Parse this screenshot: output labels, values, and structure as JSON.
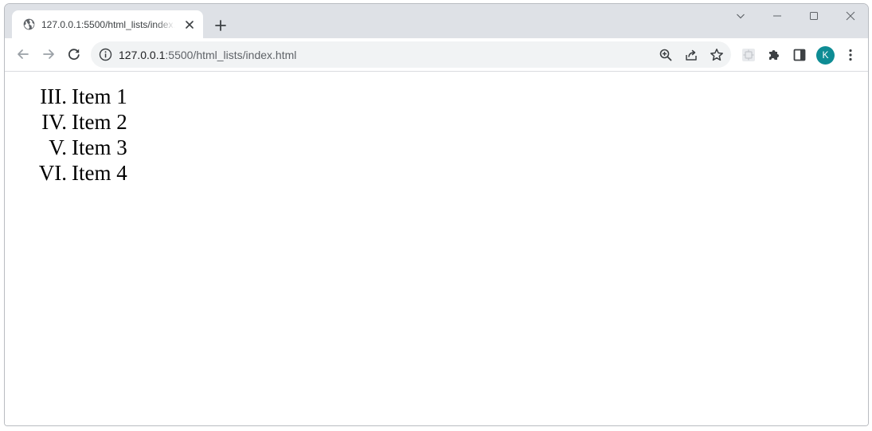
{
  "tab": {
    "title": "127.0.0.1:5500/html_lists/index.html",
    "favicon": "globe-icon",
    "close_icon": "close-icon"
  },
  "new_tab_icon": "plus-icon",
  "window_controls": [
    "tab-search-chevron-icon",
    "minimize-icon",
    "maximize-icon",
    "close-icon"
  ],
  "toolbar": {
    "back_icon": "back-arrow-icon",
    "forward_icon": "forward-arrow-icon",
    "reload_icon": "reload-icon"
  },
  "omnibox": {
    "site_info_icon": "info-icon",
    "url_host": "127.0.0.1",
    "url_rest": ":5500/html_lists/index.html",
    "icons": [
      "zoom-icon",
      "share-icon",
      "bookmark-star-icon"
    ]
  },
  "extensions": [
    "extension-icon",
    "puzzle-icon",
    "side-panel-icon"
  ],
  "profile": {
    "initial": "K",
    "color": "#0e8c94"
  },
  "menu_icon": "kebab-menu-icon",
  "list": {
    "items": [
      {
        "marker": "III.",
        "text": "Item 1"
      },
      {
        "marker": "IV.",
        "text": "Item 2"
      },
      {
        "marker": "V.",
        "text": "Item 3"
      },
      {
        "marker": "VI.",
        "text": "Item 4"
      }
    ]
  },
  "colors": {
    "tabstrip": "#dee1e6",
    "omnibox": "#f1f3f4",
    "icon": "#5f6368"
  }
}
